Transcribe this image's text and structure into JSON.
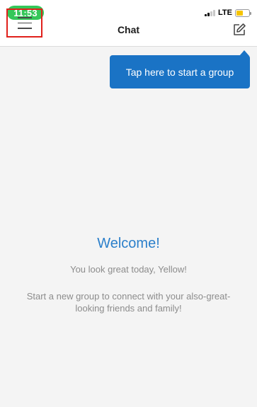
{
  "status_bar": {
    "time": "11:53",
    "network": "LTE",
    "time_pill_color": "#34c759",
    "battery_color": "#f5c400"
  },
  "nav": {
    "title": "Chat",
    "menu_icon": "hamburger-menu-icon",
    "compose_icon": "compose-icon",
    "highlight_color": "#e0201b"
  },
  "tooltip": {
    "text": "Tap here to start a group",
    "color": "#1a73c5"
  },
  "welcome": {
    "title": "Welcome!",
    "subtitle": "You look great today, Yellow!",
    "body": "Start a new group to connect with your also-great-looking friends and family!",
    "title_color": "#2b7fca"
  }
}
